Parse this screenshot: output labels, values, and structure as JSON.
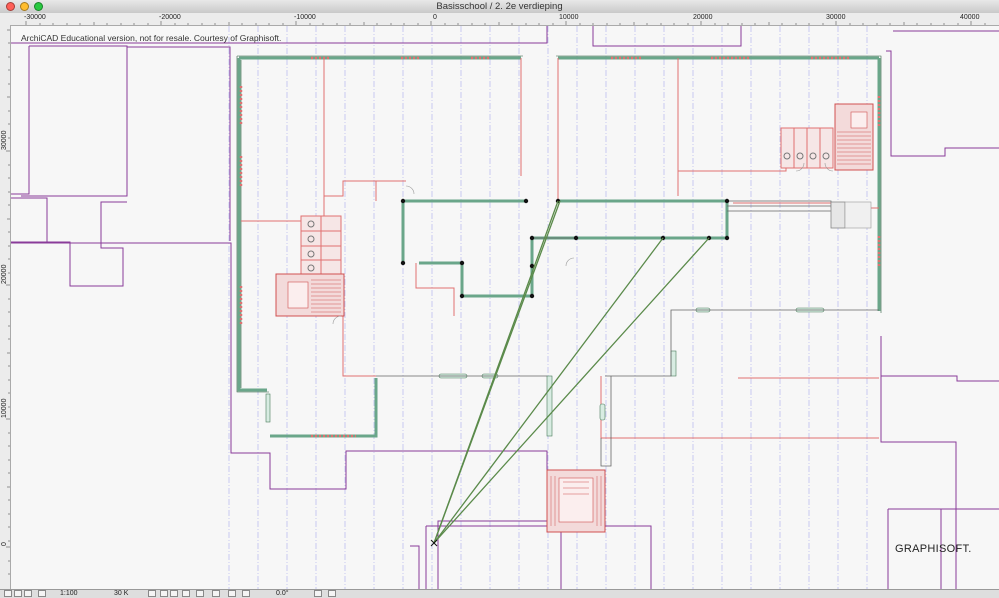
{
  "window": {
    "title": "Basisschool / 2. 2e verdieping"
  },
  "ruler": {
    "horizontal_labels": [
      "-30000",
      "-20000",
      "-10000",
      "0",
      "10000",
      "20000",
      "30000",
      "40000"
    ],
    "vertical_labels": [
      "30000",
      "20000",
      "10000",
      "0"
    ]
  },
  "canvas": {
    "notice": "ArchiCAD Educational version, not for resale. Courtesy of Graphisoft.",
    "brand": "GRAPHISOFT."
  },
  "statusbar": {
    "scale": "1:100",
    "zoom": "30 K",
    "angle": "0.0°"
  },
  "colors": {
    "wall_red": "#e07070",
    "wall_green": "#6aa68a",
    "property_purple": "#8a3b9a",
    "grid_blue": "#9aa0e0",
    "section_line": "#5a8a4a"
  }
}
